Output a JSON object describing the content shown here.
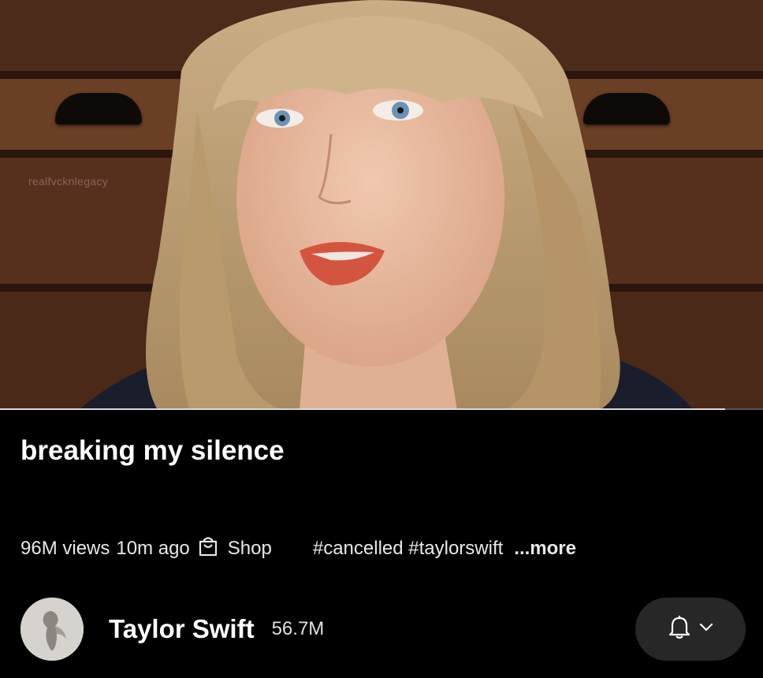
{
  "video": {
    "watermark": "realfvcknlegacy",
    "progress": 0.95
  },
  "info": {
    "title": "breaking my silence",
    "views": "96M views",
    "time_ago": "10m ago",
    "shop_label": "Shop",
    "hashtags": "#cancelled #taylorswift",
    "more_label": "...more"
  },
  "channel": {
    "name": "Taylor Swift",
    "subscribers": "56.7M"
  },
  "icons": {
    "shop": "shopping-bag-icon",
    "bell": "bell-icon",
    "chevron": "chevron-down-icon"
  }
}
